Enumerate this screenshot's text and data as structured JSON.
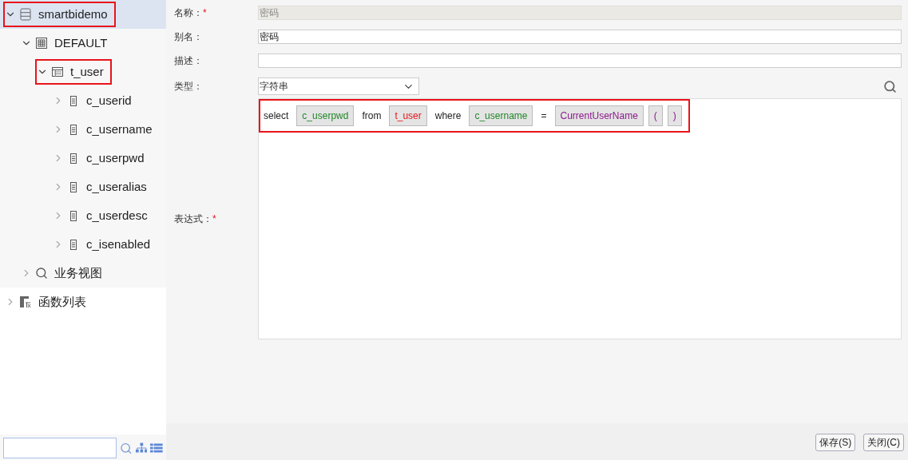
{
  "tree": [
    {
      "label": "smartbidemo",
      "kind": "database",
      "expanded": true,
      "selected": true,
      "highlighted": true,
      "children": [
        {
          "label": "DEFAULT",
          "kind": "schema",
          "expanded": true,
          "selected": false,
          "highlighted": false,
          "children": [
            {
              "label": "t_user",
              "kind": "table",
              "expanded": true,
              "selected": false,
              "highlighted": true,
              "children": [
                {
                  "label": "c_userid",
                  "kind": "column",
                  "expanded": false,
                  "selected": false,
                  "highlighted": false
                },
                {
                  "label": "c_username",
                  "kind": "column",
                  "expanded": false,
                  "selected": false,
                  "highlighted": false
                },
                {
                  "label": "c_userpwd",
                  "kind": "column",
                  "expanded": false,
                  "selected": false,
                  "highlighted": false
                },
                {
                  "label": "c_useralias",
                  "kind": "column",
                  "expanded": false,
                  "selected": false,
                  "highlighted": false
                },
                {
                  "label": "c_userdesc",
                  "kind": "column",
                  "expanded": false,
                  "selected": false,
                  "highlighted": false
                },
                {
                  "label": "c_isenabled",
                  "kind": "column",
                  "expanded": false,
                  "selected": false,
                  "highlighted": false
                }
              ]
            }
          ]
        },
        {
          "label": "业务视图",
          "kind": "view",
          "expanded": false,
          "selected": false,
          "highlighted": false
        }
      ]
    },
    {
      "label": "函数列表",
      "kind": "functions",
      "expanded": false,
      "selected": false,
      "highlighted": false
    }
  ],
  "form": {
    "name": {
      "label": "名称：",
      "required_mark": "*",
      "value": "密码",
      "disabled": true
    },
    "alias": {
      "label": "别名：",
      "value": "密码"
    },
    "description": {
      "label": "描述："
    },
    "type": {
      "label": "类型：",
      "value": "字符串"
    },
    "expression": {
      "label": "表达式：",
      "required_mark": "*",
      "highlighted": true,
      "tokens": [
        {
          "kind": "keyword",
          "text": "select"
        },
        {
          "kind": "column",
          "text": "c_userpwd"
        },
        {
          "kind": "keyword",
          "text": "from"
        },
        {
          "kind": "table",
          "text": "t_user"
        },
        {
          "kind": "keyword",
          "text": "where"
        },
        {
          "kind": "column",
          "text": "c_username"
        },
        {
          "kind": "keyword",
          "text": "="
        },
        {
          "kind": "function",
          "text": "CurrentUserName"
        },
        {
          "kind": "function",
          "text": "("
        },
        {
          "kind": "function",
          "text": ")"
        }
      ]
    }
  },
  "buttons": [
    "保存(S)",
    "关闭(C)"
  ]
}
